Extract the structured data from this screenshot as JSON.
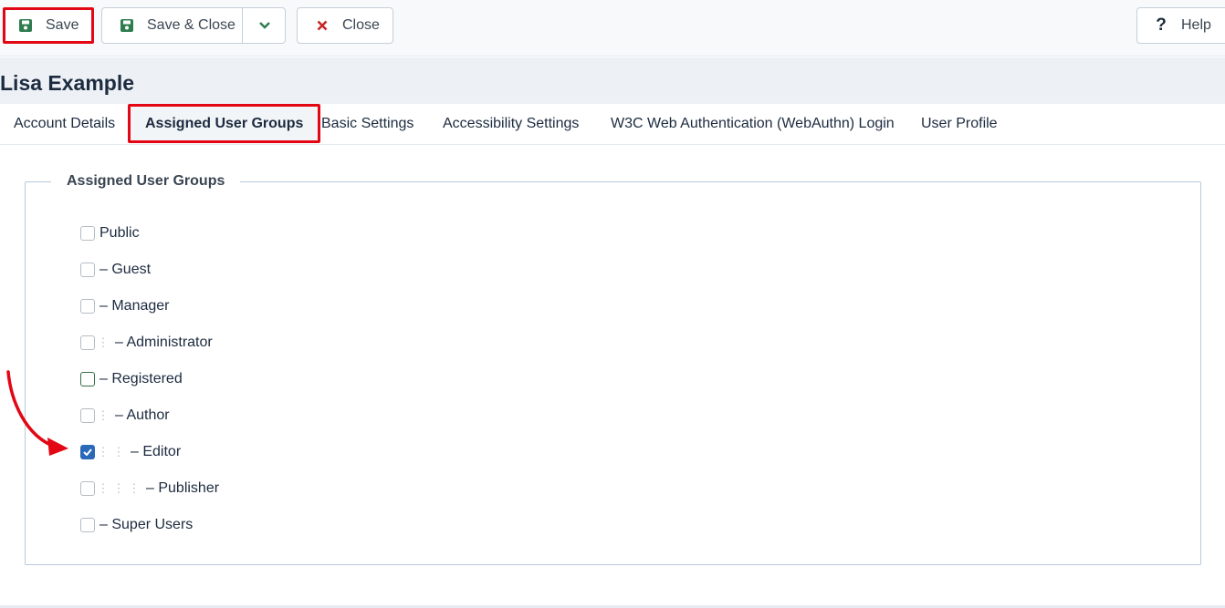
{
  "toolbar": {
    "save": {
      "label": "Save",
      "icon": "save-icon",
      "highlighted": true
    },
    "save_close": {
      "label": "Save & Close",
      "icon": "save-icon",
      "dropdown_icon": "chevron-down-icon"
    },
    "close": {
      "label": "Close",
      "icon": "close-icon"
    },
    "help": {
      "label": "Help",
      "icon": "question-icon"
    }
  },
  "page": {
    "title": "Lisa Example"
  },
  "tabs": [
    {
      "label": "Account Details",
      "active": false
    },
    {
      "label": "Assigned User Groups",
      "active": true
    },
    {
      "label": "Basic Settings",
      "active": false
    },
    {
      "label": "Accessibility Settings",
      "active": false
    },
    {
      "label": "W3C Web Authentication (WebAuthn) Login",
      "active": false
    },
    {
      "label": "User Profile",
      "active": false
    }
  ],
  "groups": {
    "legend": "Assigned User Groups",
    "items": [
      {
        "label": "Public",
        "level": 0,
        "checked": false
      },
      {
        "label": "– Guest",
        "level": 1,
        "checked": false
      },
      {
        "label": "– Manager",
        "level": 1,
        "checked": false
      },
      {
        "label": "– Administrator",
        "level": 2,
        "checked": false
      },
      {
        "label": "– Registered",
        "level": 1,
        "checked": false,
        "focused": true
      },
      {
        "label": "– Author",
        "level": 2,
        "checked": false
      },
      {
        "label": "– Editor",
        "level": 3,
        "checked": true
      },
      {
        "label": "– Publisher",
        "level": 4,
        "checked": false
      },
      {
        "label": "– Super Users",
        "level": 1,
        "checked": false
      }
    ]
  },
  "colors": {
    "highlight": "#e30613",
    "save_icon": "#2f7d4f",
    "close_icon": "#c52827",
    "checkbox_checked": "#2a69b8",
    "annotation_arrow": "#e30613"
  }
}
